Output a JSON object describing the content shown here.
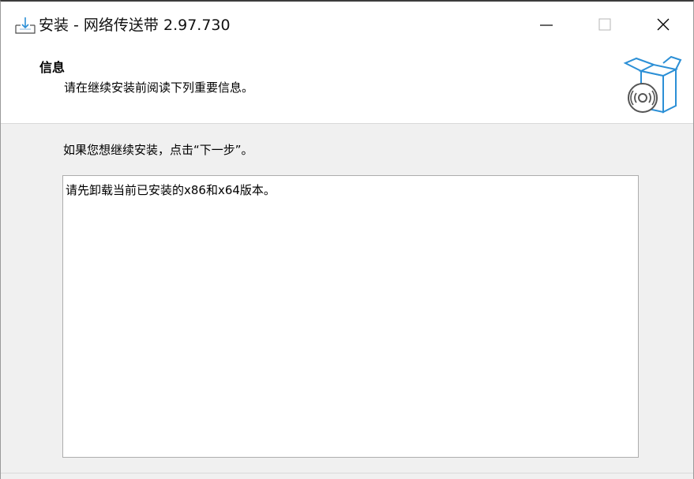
{
  "window": {
    "title": "安装 - 网络传送带 2.97.730"
  },
  "header": {
    "title": "信息",
    "subtitle": "请在继续安装前阅读下列重要信息。"
  },
  "body": {
    "instruction": "如果您想继续安装，点击“下一步”。",
    "info_text": "请先卸载当前已安装的x86和x64版本。"
  },
  "icons": {
    "app": "installer-icon",
    "art": "box-disc-icon",
    "minimize": "minimize-icon",
    "maximize": "maximize-icon",
    "close": "close-icon"
  },
  "colors": {
    "accent": "#2b8fd6",
    "panel": "#f0f0f0"
  }
}
